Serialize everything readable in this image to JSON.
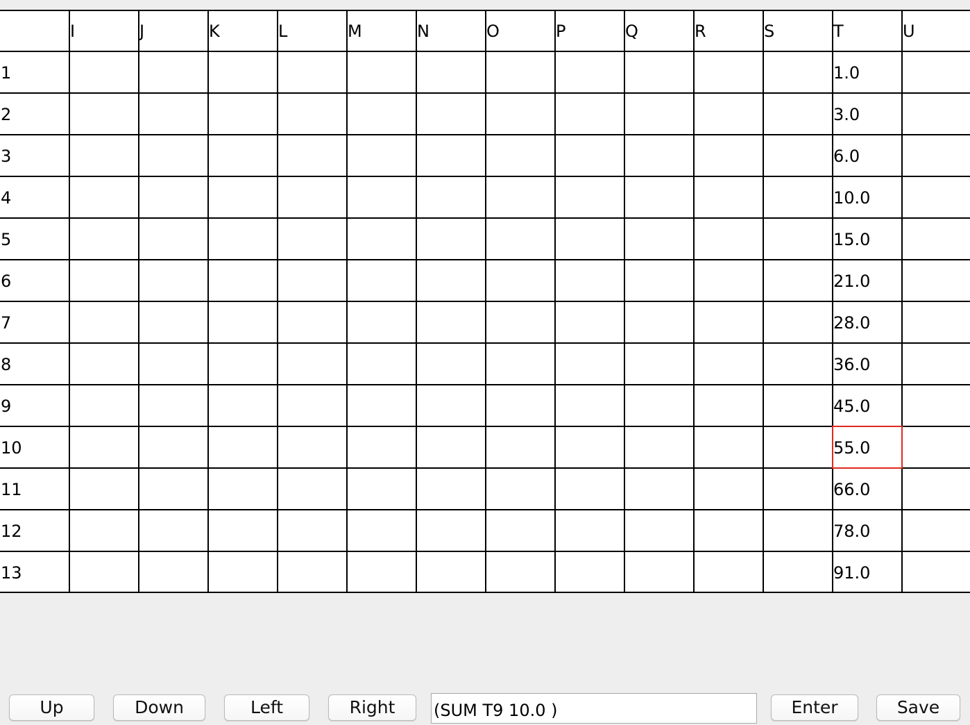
{
  "spreadsheet": {
    "column_headers": [
      "",
      "I",
      "J",
      "K",
      "L",
      "M",
      "N",
      "O",
      "P",
      "Q",
      "R",
      "S",
      "T",
      "U"
    ],
    "rows": [
      [
        "1",
        "",
        "",
        "",
        "",
        "",
        "",
        "",
        "",
        "",
        "",
        "",
        "1.0",
        ""
      ],
      [
        "2",
        "",
        "",
        "",
        "",
        "",
        "",
        "",
        "",
        "",
        "",
        "",
        "3.0",
        ""
      ],
      [
        "3",
        "",
        "",
        "",
        "",
        "",
        "",
        "",
        "",
        "",
        "",
        "",
        "6.0",
        ""
      ],
      [
        "4",
        "",
        "",
        "",
        "",
        "",
        "",
        "",
        "",
        "",
        "",
        "",
        "10.0",
        ""
      ],
      [
        "5",
        "",
        "",
        "",
        "",
        "",
        "",
        "",
        "",
        "",
        "",
        "",
        "15.0",
        ""
      ],
      [
        "6",
        "",
        "",
        "",
        "",
        "",
        "",
        "",
        "",
        "",
        "",
        "",
        "21.0",
        ""
      ],
      [
        "7",
        "",
        "",
        "",
        "",
        "",
        "",
        "",
        "",
        "",
        "",
        "",
        "28.0",
        ""
      ],
      [
        "8",
        "",
        "",
        "",
        "",
        "",
        "",
        "",
        "",
        "",
        "",
        "",
        "36.0",
        ""
      ],
      [
        "9",
        "",
        "",
        "",
        "",
        "",
        "",
        "",
        "",
        "",
        "",
        "",
        "45.0",
        ""
      ],
      [
        "10",
        "",
        "",
        "",
        "",
        "",
        "",
        "",
        "",
        "",
        "",
        "",
        "55.0",
        ""
      ],
      [
        "11",
        "",
        "",
        "",
        "",
        "",
        "",
        "",
        "",
        "",
        "",
        "",
        "66.0",
        ""
      ],
      [
        "12",
        "",
        "",
        "",
        "",
        "",
        "",
        "",
        "",
        "",
        "",
        "",
        "78.0",
        ""
      ],
      [
        "13",
        "",
        "",
        "",
        "",
        "",
        "",
        "",
        "",
        "",
        "",
        "",
        "91.0",
        ""
      ]
    ],
    "selected_cell": "T10",
    "selection_color": "#e0281e",
    "grid_line_color": "#000000",
    "cell_background": "#ffffff",
    "window_background": "#eeeeee"
  },
  "toolbar": {
    "up_label": "Up",
    "down_label": "Down",
    "left_label": "Left",
    "right_label": "Right",
    "formula_value": "(SUM T9 10.0 )",
    "enter_label": "Enter",
    "save_label": "Save"
  }
}
